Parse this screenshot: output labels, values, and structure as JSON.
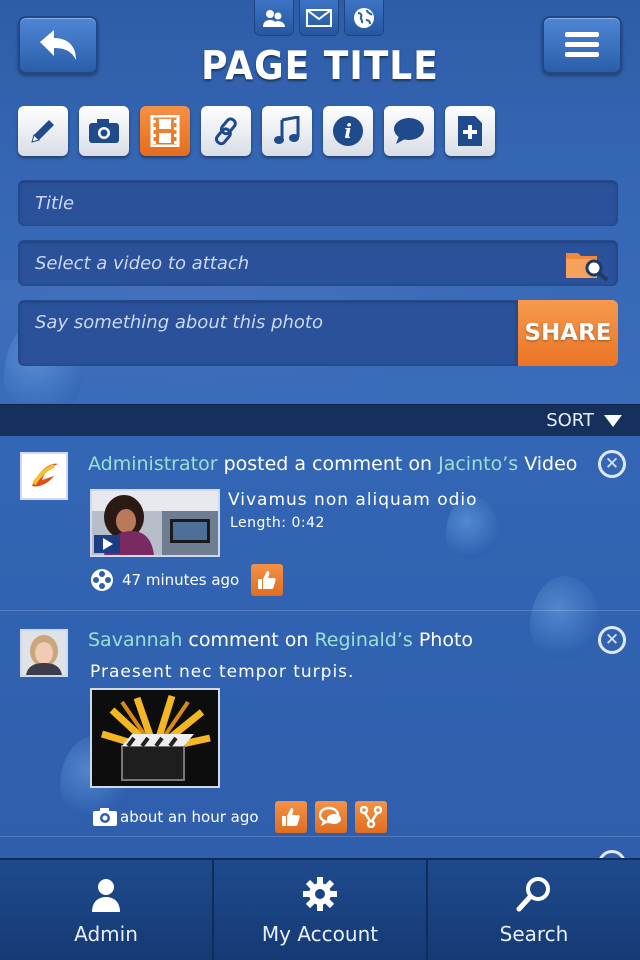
{
  "header": {
    "title": "PAGE TITLE",
    "top_icons": [
      "users-icon",
      "mail-icon",
      "globe-icon"
    ],
    "back_icon": "back-arrow-icon",
    "menu_icon": "hamburger-icon"
  },
  "toolbar": {
    "tools": [
      "pencil-icon",
      "camera-icon",
      "film-icon",
      "link-icon",
      "music-icon",
      "info-icon",
      "speech-bubble-icon",
      "add-document-icon"
    ],
    "active_tool": "film-icon"
  },
  "composer": {
    "title_placeholder": "Title",
    "video_placeholder": "Select a video to attach",
    "message_placeholder": "Say something about this photo",
    "share_label": "SHARE"
  },
  "sort": {
    "label": "SORT"
  },
  "feed": [
    {
      "actor": "Administrator",
      "action": "posted a comment on",
      "target": "Jacinto’s",
      "object": "Video",
      "description": "Vivamus non aliquam odio",
      "length": "Length: 0:42",
      "time": "47 minutes ago"
    },
    {
      "actor": "Savannah",
      "action": "comment on",
      "target": "Reginald’s",
      "object": "Photo",
      "description": "Praesent nec tempor turpis.",
      "time": "about an hour ago"
    }
  ],
  "tabs": [
    {
      "label": "Admin",
      "icon": "user-icon"
    },
    {
      "label": "My Account",
      "icon": "gear-icon"
    },
    {
      "label": "Search",
      "icon": "search-icon"
    }
  ],
  "colors": {
    "accent": "#ea7424",
    "name_link": "#98e0d2",
    "background": "#2f5aa9"
  }
}
